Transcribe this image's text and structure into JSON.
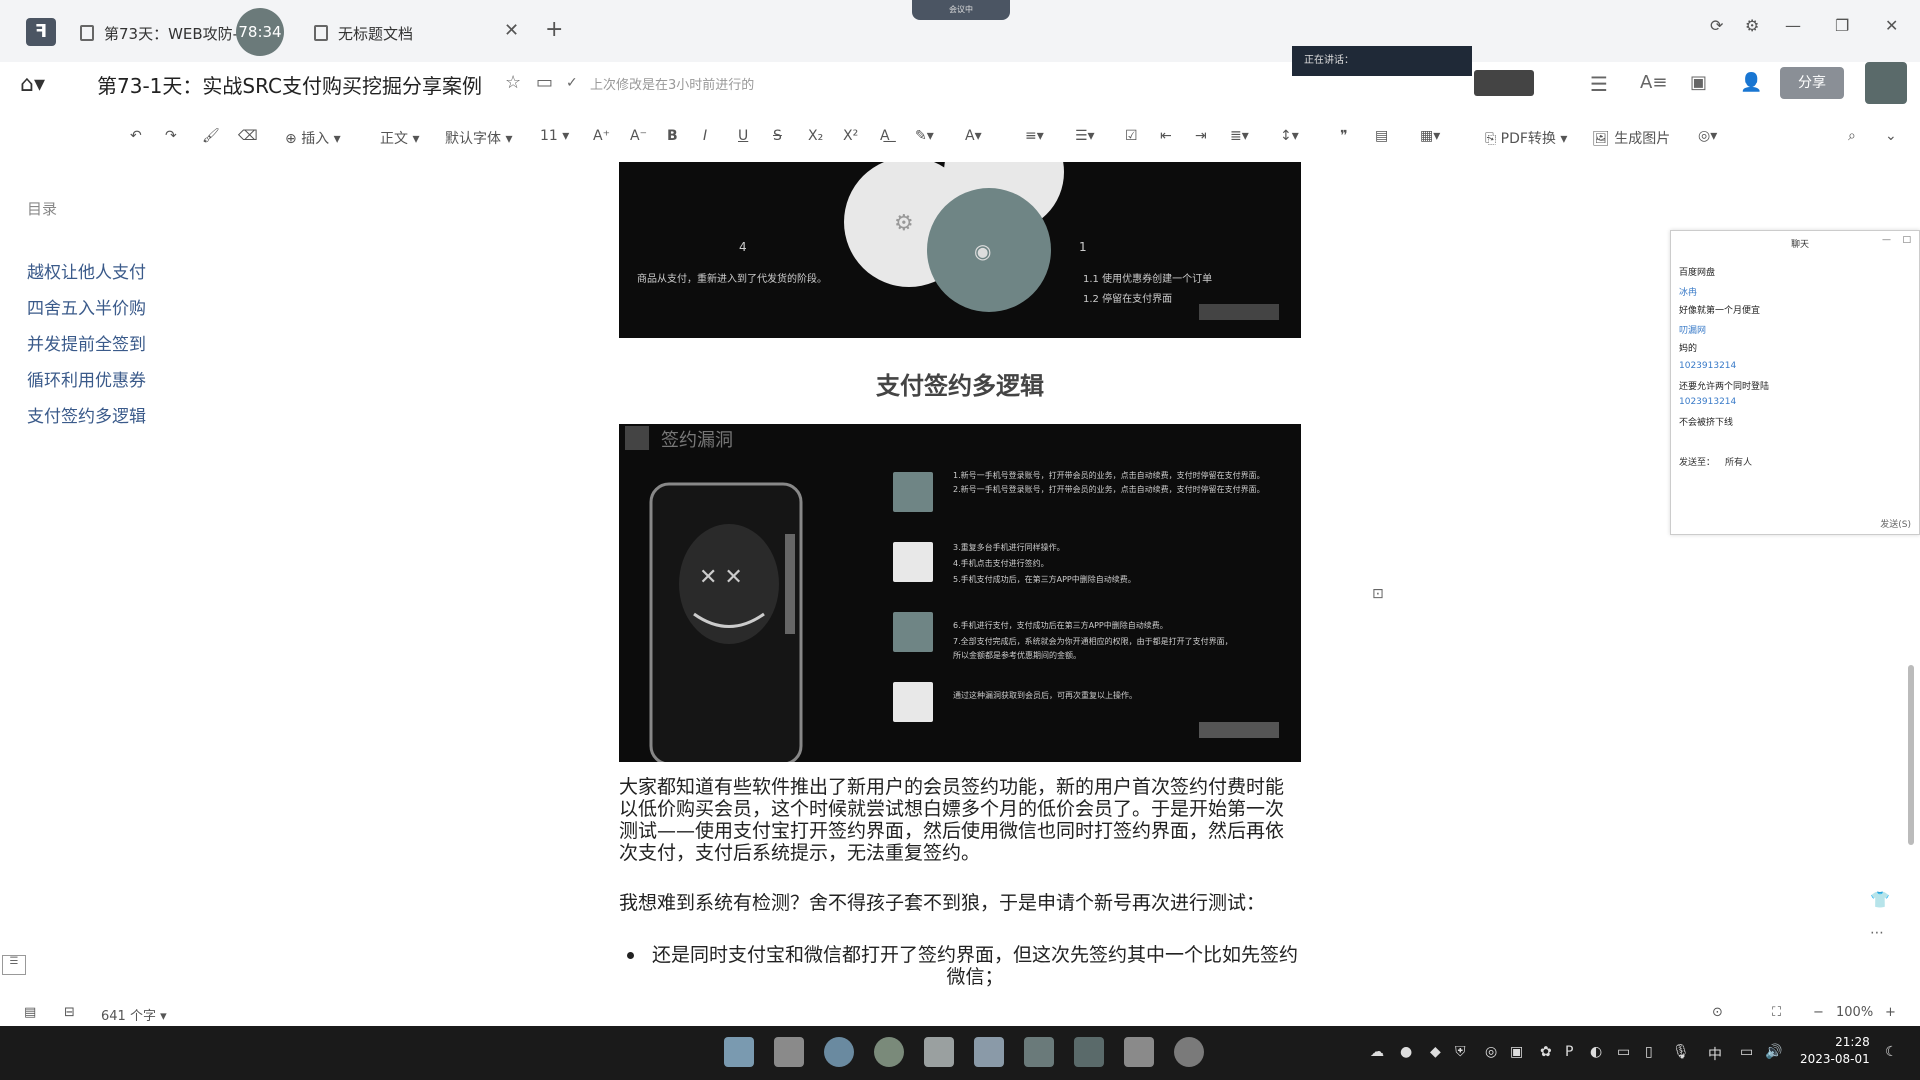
{
  "tabs": [
    {
      "label": "第73天：WEB攻防-支"
    },
    {
      "label": "无标题文档"
    }
  ],
  "timer": "78:34",
  "meeting_pill": "会议中",
  "doc": {
    "title": "第73-1天：实战SRC支付购买挖掘分享案例",
    "save_status": "上次修改是在3小时前进行的"
  },
  "speaking": "正在讲话：",
  "share_label": "分享",
  "toolbar": {
    "insert": "插入",
    "style": "正文",
    "font": "默认字体",
    "size": "11",
    "pdf": "PDF转换",
    "image": "生成图片"
  },
  "outline": {
    "title": "目录",
    "items": [
      "越权让他人支付",
      "四舍五入半价购",
      "并发提前全签到",
      "循环利用优惠券",
      "支付签约多逻辑"
    ]
  },
  "slide1": {
    "num_left": "4",
    "text_left": "商品从支付，重新进入到了代发货的阶段。",
    "num_right": "1",
    "step1": "1.1  使用优惠券创建一个订单",
    "step2": "1.2  停留在支付界面"
  },
  "section_heading": "支付签约多逻辑",
  "slide2": {
    "title": "签约漏洞",
    "lines": [
      "1.新号一手机号登录账号，打开带会员的业务，点击自动续费，支付时停留在支付界面。",
      "2.新号一手机号登录账号，打开带会员的业务，点击自动续费，支付时停留在支付界面。",
      "3.重复多台手机进行同样操作。",
      "4.手机点击支付进行签约。",
      "5.手机支付成功后，在第三方APP中删除自动续费。",
      "6.手机进行支付，支付成功后在第三方APP中删除自动续费。",
      "7.全部支付完成后，系统就会为你开通相应的权限，由于都是打开了支付界面，",
      "所以金额都是参考优惠期间的金额。",
      "通过这种漏洞获取到会员后，可再次重复以上操作。"
    ]
  },
  "paragraphs": [
    "大家都知道有些软件推出了新用户的会员签约功能，新的用户首次签约付费时能以低价购买会员，这个时候就尝试想白嫖多个月的低价会员了。于是开始第一次测试——使用支付宝打开签约界面，然后使用微信也同时打签约界面，然后再依次支付，支付后系统提示，无法重复签约。",
    "我想难到系统有检测？舍不得孩子套不到狼，于是申请个新号再次进行测试："
  ],
  "bullets": [
    "还是同时支付宝和微信都打开了签约界面，但这次先签约其中一个比如先签约微信；"
  ],
  "chat": {
    "title": "聊天",
    "messages": [
      {
        "name": "",
        "text": "百度网盘"
      },
      {
        "name": "冰冉",
        "text": "好像就第一个月便宜"
      },
      {
        "name": "叨漏网",
        "text": "妈的"
      },
      {
        "name": "1023913214",
        "text": "还要允许两个同时登陆"
      },
      {
        "name": "1023913214",
        "text": "不会被挤下线"
      }
    ],
    "send_to_label": "发送至：",
    "recipient": "所有人",
    "send_button": "发送(S)"
  },
  "statusbar": {
    "word_count": "641 个字",
    "zoom": "100%"
  },
  "clock": {
    "time": "21:28",
    "date": "2023-08-01"
  },
  "colors": {
    "accent": "#3a5a8a",
    "chat_name": "#3a7bc8",
    "taskbar": "#1a1a1a"
  }
}
